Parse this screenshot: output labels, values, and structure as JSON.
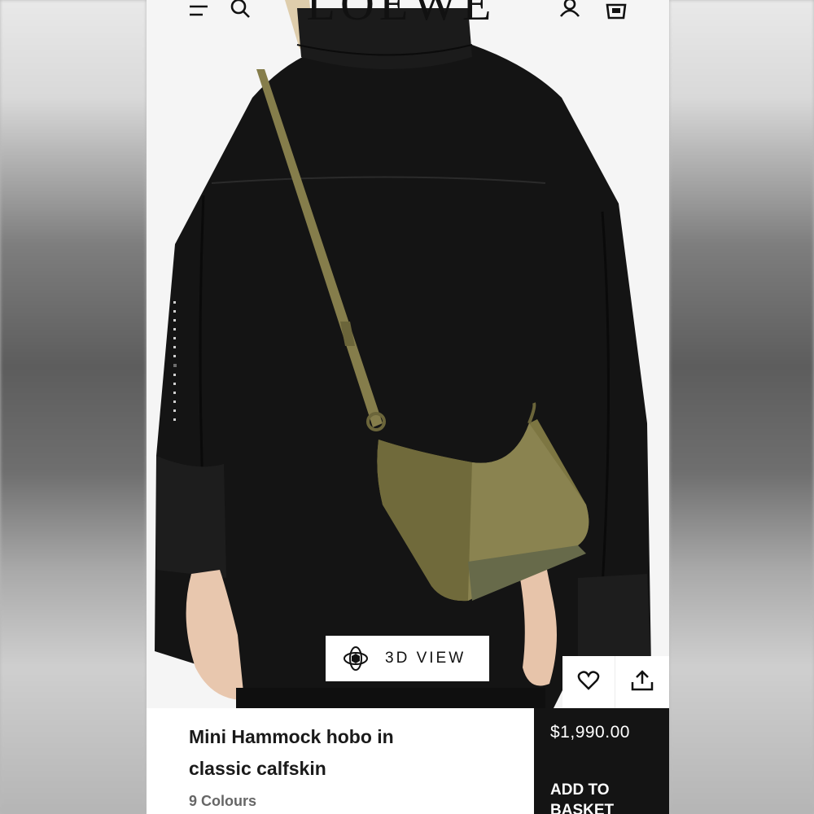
{
  "header": {
    "logo": "LOEWE",
    "menu_icon": "menu-icon",
    "search_icon": "search-icon",
    "account_icon": "account-icon",
    "basket_icon": "basket-icon"
  },
  "gallery": {
    "dot_count": 14,
    "active_index": 7
  },
  "view3d": {
    "label": "3D VIEW",
    "icon": "3d-rotate-icon"
  },
  "actions": {
    "wishlist_icon": "heart-icon",
    "share_icon": "share-icon"
  },
  "product": {
    "name": "Mini Hammock hobo in classic calfskin",
    "colours": "9 Colours",
    "price": "$1,990.00",
    "add_to_basket": "ADD TO BASKET"
  },
  "colors": {
    "panel_dark": "#141414",
    "bag_khaki": "#7d7642"
  }
}
